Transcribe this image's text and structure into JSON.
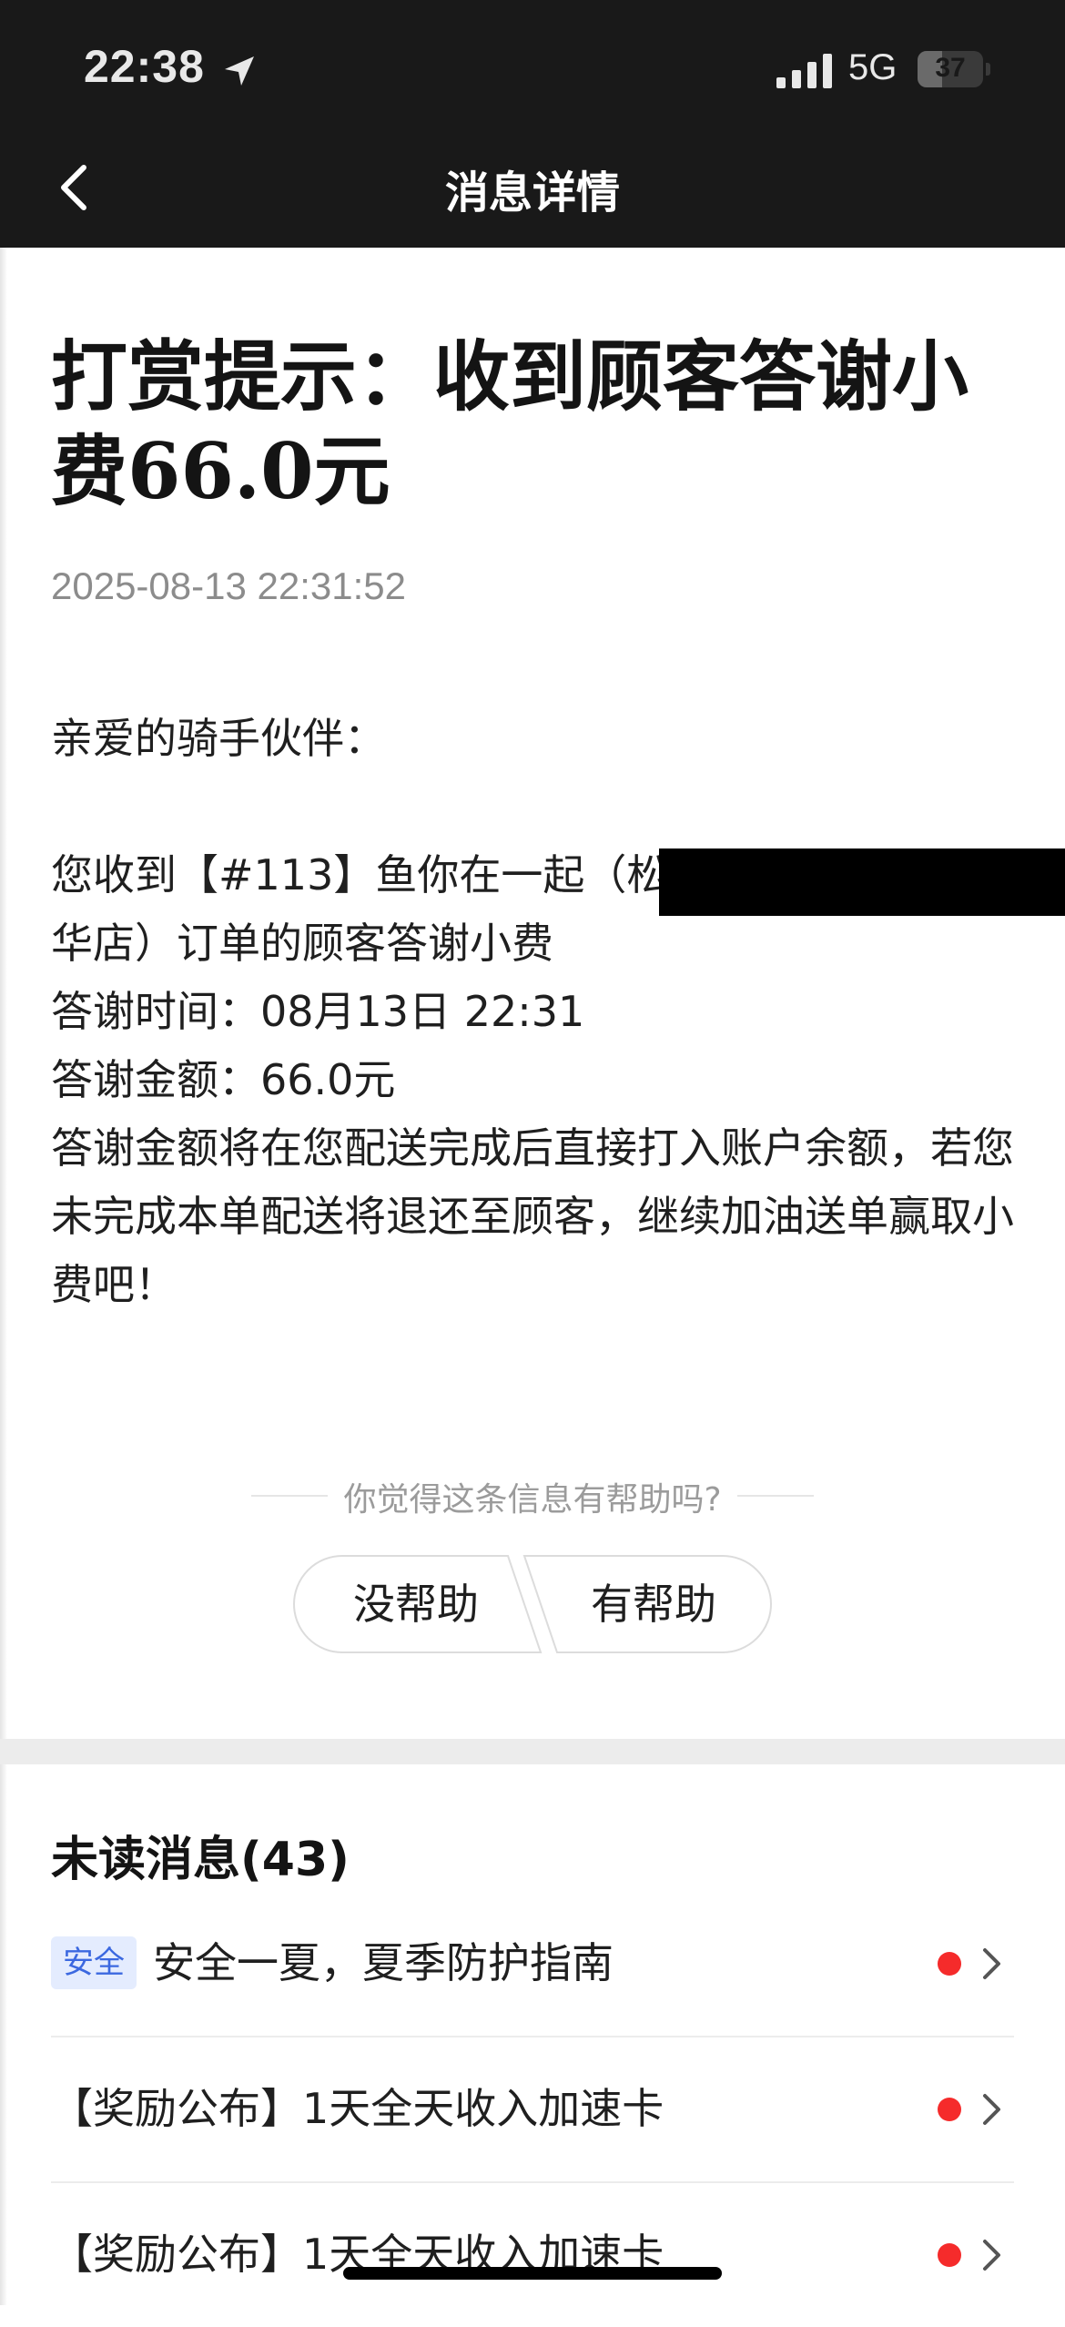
{
  "status_bar": {
    "time": "22:38",
    "network": "5G",
    "battery": "37",
    "battery_level": 0.37
  },
  "header": {
    "title": "消息详情",
    "back_icon": "chevron-left-icon"
  },
  "message": {
    "title": "打赏提示：收到顾客答谢小费66.0元",
    "time": "2025-08-13 22:31:52",
    "greeting": "亲爱的骑手伙伴：",
    "order_text": "您收到【#113】鱼你在一起（松\n华店）订单的顾客答谢小费",
    "thanks_time": "答谢时间：08月13日 22:31",
    "thanks_amount": "答谢金额：66.0元",
    "note": "答谢金额将在您配送完成后直接打入账户余额，若您未完成本单配送将退还至顾客，继续加油送单赢取小费吧！"
  },
  "feedback": {
    "question": "你觉得这条信息有帮助吗?",
    "no_label": "没帮助",
    "yes_label": "有帮助"
  },
  "unread": {
    "title": "未读消息(43)",
    "items": [
      {
        "tag": "安全",
        "text": "安全一夏，夏季防护指南"
      },
      {
        "tag": "",
        "text": "【奖励公布】1天全天收入加速卡"
      },
      {
        "tag": "",
        "text": "【奖励公布】1天全天收入加速卡"
      }
    ],
    "dot_color": "#f52b2b",
    "tag_color": "#3b68e0"
  }
}
